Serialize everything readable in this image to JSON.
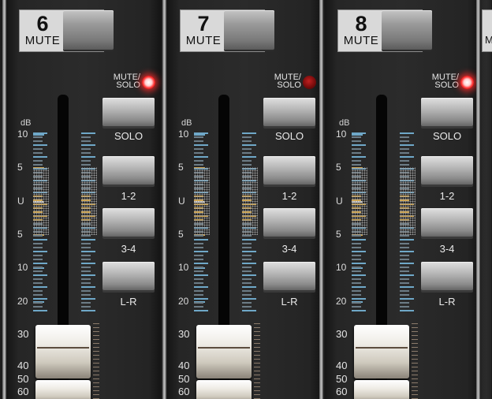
{
  "channels": [
    {
      "number": "6",
      "mute_label": "MUTE",
      "mute_solo_label_line1": "MUTE/",
      "mute_solo_label_line2": "SOLO",
      "led_lit": true,
      "db_label": "dB",
      "scale": [
        "10",
        "5",
        "U",
        "5",
        "10",
        "20",
        "30",
        "40",
        "50",
        "60"
      ],
      "buttons": [
        "SOLO",
        "1-2",
        "3-4",
        "L-R"
      ]
    },
    {
      "number": "7",
      "mute_label": "MUTE",
      "mute_solo_label_line1": "MUTE/",
      "mute_solo_label_line2": "SOLO",
      "led_lit": false,
      "db_label": "dB",
      "scale": [
        "10",
        "5",
        "U",
        "5",
        "10",
        "20",
        "30",
        "40",
        "50",
        "60"
      ],
      "buttons": [
        "SOLO",
        "1-2",
        "3-4",
        "L-R"
      ]
    },
    {
      "number": "8",
      "mute_label": "MUTE",
      "mute_solo_label_line1": "MUTE/",
      "mute_solo_label_line2": "SOLO",
      "led_lit": true,
      "db_label": "dB",
      "scale": [
        "10",
        "5",
        "U",
        "5",
        "10",
        "20",
        "30",
        "40",
        "50",
        "60"
      ],
      "buttons": [
        "SOLO",
        "1-2",
        "3-4",
        "L-R"
      ]
    }
  ],
  "partial_channel_label": "M",
  "colors": {
    "led_on": "#ff3030",
    "led_off": "#7a0c0c",
    "meter_blue": "#6fa8c8",
    "meter_yellow": "#d6a84a"
  }
}
